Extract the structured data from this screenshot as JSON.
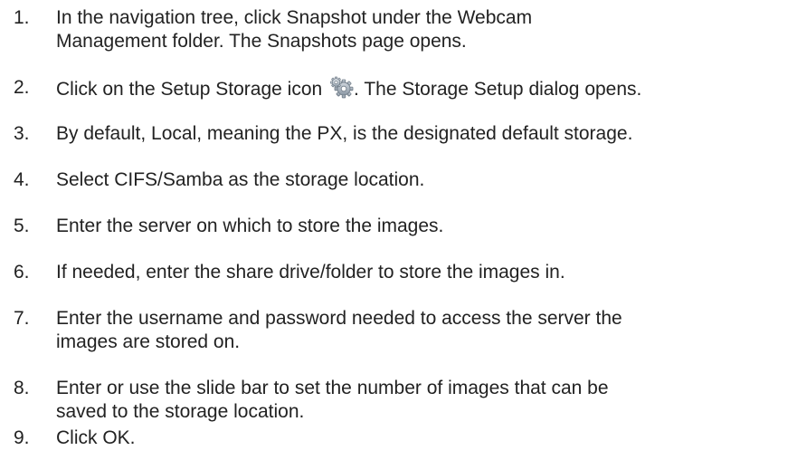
{
  "steps": [
    {
      "number": "1.",
      "lines": [
        "In the navigation tree, click Snapshot under the Webcam",
        "Management folder. The Snapshots page opens."
      ]
    },
    {
      "number": "2.",
      "text_before_icon": "Click on the Setup Storage icon",
      "icon": "gear-icon",
      "text_after_icon": ". The Storage Setup dialog opens."
    },
    {
      "number": "3.",
      "lines": [
        "By default, Local, meaning the PX, is the designated default storage."
      ]
    },
    {
      "number": "4.",
      "lines": [
        "Select CIFS/Samba as the storage location."
      ]
    },
    {
      "number": "5.",
      "lines": [
        "Enter the server on which to store the images."
      ]
    },
    {
      "number": "6.",
      "lines": [
        "If needed, enter the share drive/folder to store the images in."
      ]
    },
    {
      "number": "7.",
      "lines": [
        "Enter the username and password needed to access the server the",
        "images are stored on."
      ]
    },
    {
      "number": "8.",
      "lines": [
        "Enter or use the slide bar to set the number of images that can be",
        "saved to the storage location."
      ]
    },
    {
      "number": "9.",
      "lines": [
        "Click OK."
      ]
    }
  ]
}
